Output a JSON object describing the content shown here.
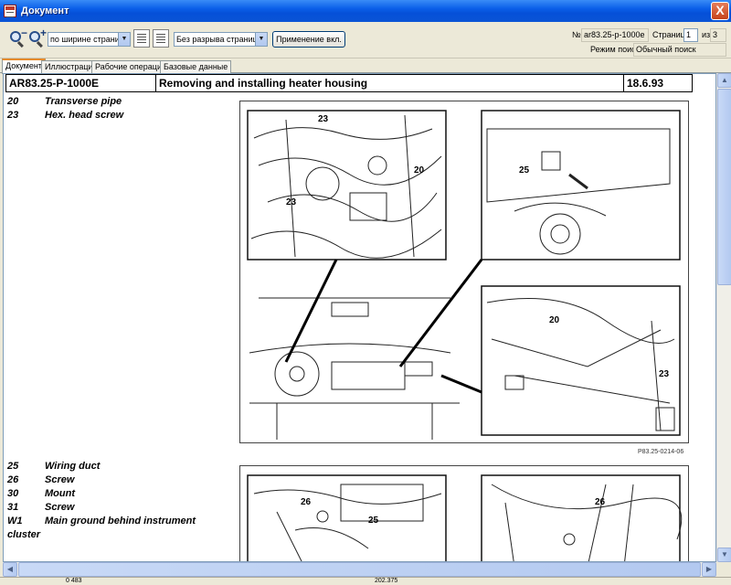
{
  "window": {
    "title": "Документ",
    "close_label": "X"
  },
  "toolbar": {
    "zoom_mode": "по ширине страницы",
    "page_mode": "Без разрыва страниц",
    "apply_label": "Применение вкл.",
    "doc_number_label": "№",
    "doc_number_value": "ar83.25-p-1000e",
    "page_label": "Страница",
    "page_value": "1",
    "of_label": "из",
    "page_total": "3",
    "search_mode_label": "Режим поиска",
    "search_mode_value": "Обычный поиск"
  },
  "tabs": [
    {
      "label": "Документ"
    },
    {
      "label": "Иллюстрация"
    },
    {
      "label": "Рабочие операции"
    },
    {
      "label": "Базовые данные"
    }
  ],
  "document": {
    "code": "AR83.25-P-1000E",
    "title": "Removing and installing heater housing",
    "date": "18.6.93",
    "legend1": [
      {
        "num": "20",
        "text": "Transverse pipe"
      },
      {
        "num": "23",
        "text": "Hex. head screw"
      }
    ],
    "figure1_caption": "P83.25-0214-06",
    "legend2": [
      {
        "num": "25",
        "text": "Wiring duct"
      },
      {
        "num": "26",
        "text": "Screw"
      },
      {
        "num": "30",
        "text": "Mount"
      },
      {
        "num": "31",
        "text": "Screw"
      },
      {
        "num": "W1",
        "text": "Main ground behind instrument"
      }
    ],
    "legend2_wrap": "cluster",
    "callouts": [
      "23",
      "20",
      "23",
      "25",
      "20",
      "23",
      "26",
      "25",
      "26"
    ]
  },
  "statusbar": {
    "left": "0 483",
    "right": "202.375"
  }
}
